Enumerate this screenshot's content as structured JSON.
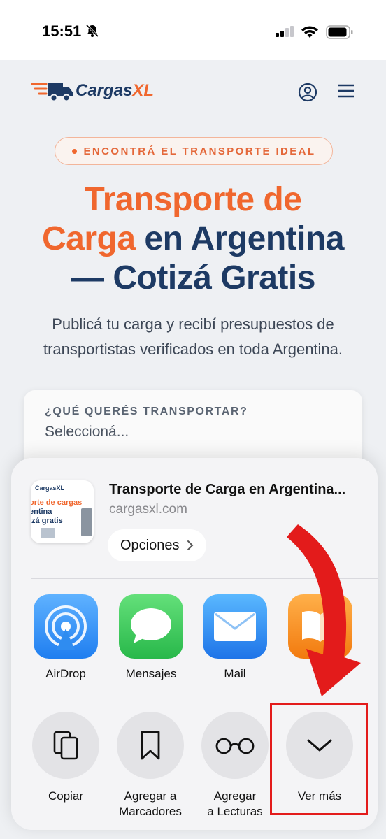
{
  "status_bar": {
    "time": "15:51"
  },
  "site": {
    "brand": {
      "cargas": "Cargas",
      "xl": "XL"
    },
    "pill": "ENCONTRÁ EL TRANSPORTE IDEAL",
    "hero": {
      "line1": "Transporte de",
      "line2_orange": "Carga",
      "line2_blue": " en Argentina",
      "line3": "— Cotizá Gratis"
    },
    "subtitle": "Publicá tu carga y recibí presupuestos de transportistas verificados en toda Argentina.",
    "form": {
      "question": "¿QUÉ QUERÉS TRANSPORTAR?",
      "select_value": "Seleccioná..."
    }
  },
  "share_sheet": {
    "preview": {
      "title": "Transporte de Carga en Argentina...",
      "domain": "cargasxl.com",
      "options_label": "Opciones",
      "thumb_brand": "CargasXL",
      "thumb_line1": "orte de cargas",
      "thumb_line2": "entina",
      "thumb_line3": "izá gratis"
    },
    "apps": [
      {
        "label": "AirDrop",
        "icon": "airdrop-icon",
        "color": "#2f8cf0"
      },
      {
        "label": "Mensajes",
        "icon": "messages-icon",
        "color": "#3ccb5a"
      },
      {
        "label": "Mail",
        "icon": "mail-icon",
        "color": "#2e8cf2"
      },
      {
        "label": "Li",
        "icon": "books-icon",
        "color": "#f28a1c"
      }
    ],
    "actions": [
      {
        "line1": "Copiar",
        "line2": "",
        "icon": "copy-icon"
      },
      {
        "line1": "Agregar a",
        "line2": "Marcadores",
        "icon": "bookmark-icon"
      },
      {
        "line1": "Agregar",
        "line2": "a Lecturas",
        "icon": "glasses-icon"
      },
      {
        "line1": "Ver más",
        "line2": "",
        "icon": "chevron-down-icon"
      }
    ]
  },
  "colors": {
    "orange": "#f0672e",
    "navy": "#1d3a64",
    "annotation_red": "#e31b1b"
  }
}
